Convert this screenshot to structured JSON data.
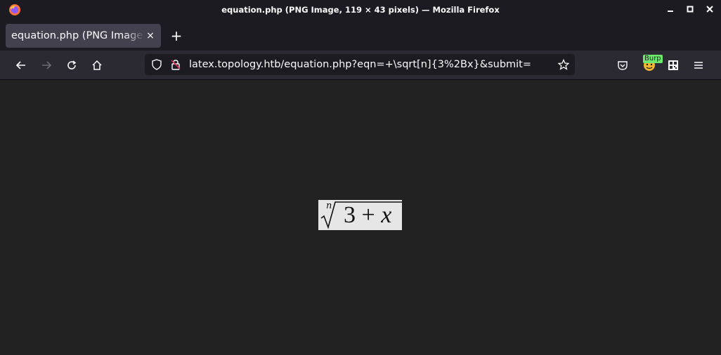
{
  "window": {
    "title": "equation.php (PNG Image, 119 × 43 pixels) — Mozilla Firefox",
    "controls": {
      "minimize": "▁",
      "maximize": "▢",
      "close": "✕"
    }
  },
  "tabs": [
    {
      "label": "equation.php (PNG Image, 119",
      "close": "×"
    }
  ],
  "new_tab_label": "+",
  "navigation": {
    "url": "latex.topology.htb/equation.php?eqn=+\\sqrt[n]{3%2Bx}&submit="
  },
  "extensions": {
    "burp_badge": "Burp"
  },
  "content": {
    "equation": {
      "root_index": "n",
      "radicand_number": "3",
      "operator": "+",
      "variable": "x"
    }
  },
  "colors": {
    "titlebar_bg": "#1c1b22",
    "tab_active_bg": "#42414d",
    "navbar_bg": "#2b2a33",
    "urlbar_bg": "#1c1b22",
    "content_bg": "#222222",
    "image_bg": "#e6e6e6",
    "burp_badge_bg": "#6ee96e"
  }
}
